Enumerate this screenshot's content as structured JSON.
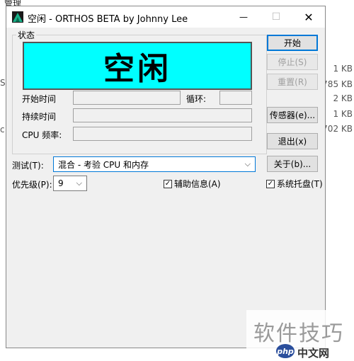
{
  "background": {
    "top_text": "管理",
    "side_letters": [
      "S",
      "c"
    ],
    "file_sizes": [
      "1 KB",
      "785 KB",
      "2 KB",
      "1 KB",
      "702 KB"
    ]
  },
  "window": {
    "title": "空闲 - ORTHOS BETA by Johnny Lee",
    "controls": {
      "minimize": "—",
      "maximize": "☐",
      "close": "✕"
    }
  },
  "status_group": {
    "label": "状态",
    "status_text": "空闲",
    "status_color": "#00ffff",
    "start_time_label": "开始时间",
    "start_time_value": "",
    "loop_label": "循环:",
    "loop_value": "",
    "duration_label": "持续时间",
    "duration_value": "",
    "cpu_freq_label": "CPU 频率:",
    "cpu_freq_value": ""
  },
  "buttons": {
    "start": "开始",
    "stop": "停止(S)",
    "reset": "重置(R)",
    "sensors": "传感器(e)...",
    "exit": "退出(x)",
    "about": "关于(b)..."
  },
  "test": {
    "label": "测试(T):",
    "selected": "混合 - 考验 CPU 和内存"
  },
  "priority": {
    "label": "优先级(P):",
    "selected": "9"
  },
  "checkboxes": {
    "aux_info": {
      "label": "辅助信息(A)",
      "checked": true
    },
    "system_tray": {
      "label": "系统托盘(T)",
      "checked": true
    }
  },
  "watermark": {
    "main": "软件技巧",
    "logo": "php",
    "sub": "中文网"
  }
}
